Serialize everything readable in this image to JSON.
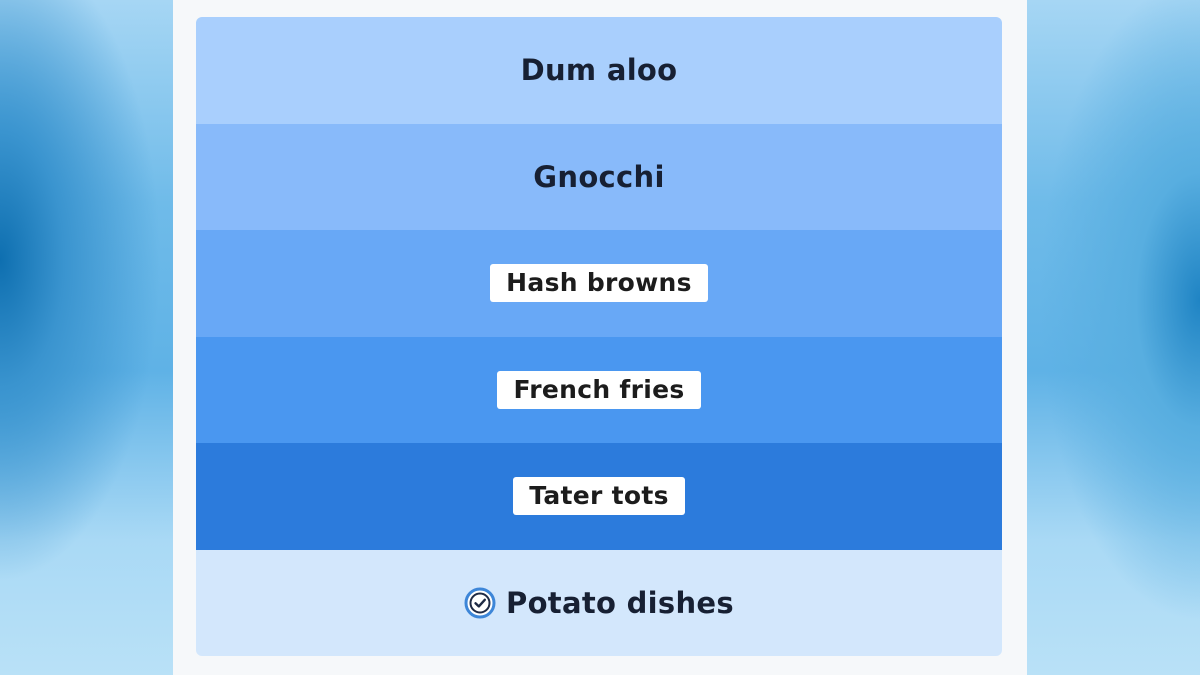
{
  "rows": [
    {
      "label": "Dum aloo",
      "style": "plain",
      "color": "#a9cffd"
    },
    {
      "label": "Gnocchi",
      "style": "plain",
      "color": "#88bafa"
    },
    {
      "label": "Hash browns",
      "style": "chip",
      "color": "#68a8f6"
    },
    {
      "label": "French fries",
      "style": "chip",
      "color": "#4a97f0"
    },
    {
      "label": "Tater tots",
      "style": "chip",
      "color": "#2c7bdc"
    }
  ],
  "footer": {
    "label": "Potato dishes",
    "icon": "check-circle-icon",
    "color": "#d3e7fc",
    "icon_color": "#3d86d8"
  }
}
